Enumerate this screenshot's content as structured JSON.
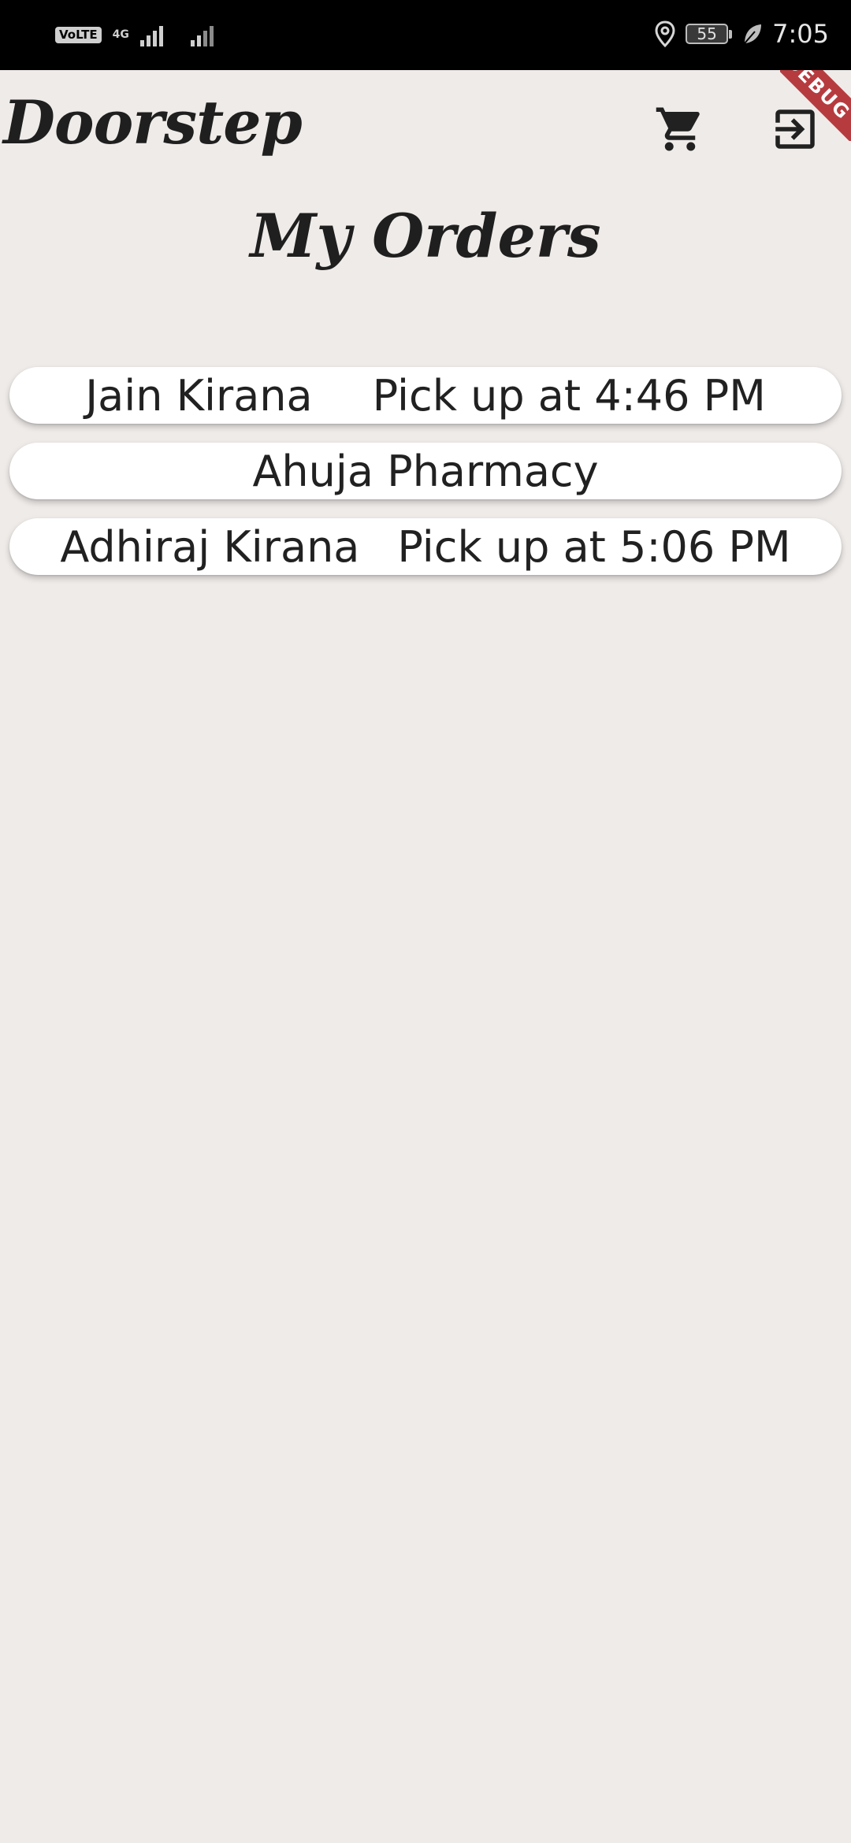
{
  "status_bar": {
    "network_badge": "VoLTE",
    "network_type": "4G",
    "battery": "55",
    "time": "7:05",
    "icons": [
      "signal-icon",
      "location-icon",
      "battery-icon",
      "leaf-icon"
    ]
  },
  "debug_banner": "DEBUG",
  "app_bar": {
    "brand": "Doorstep",
    "actions": [
      "cart-icon",
      "logout-icon"
    ]
  },
  "page": {
    "title": "My Orders"
  },
  "orders": [
    {
      "store": "Jain Kirana",
      "pickup": "Pick up at 4:46 PM"
    },
    {
      "store": "Ahuja Pharmacy",
      "pickup": ""
    },
    {
      "store": "Adhiraj Kirana",
      "pickup": "Pick up at 5:06 PM"
    }
  ],
  "colors": {
    "background": "#efebe9",
    "card": "#ffffff",
    "text": "#212121",
    "status_bar": "#000000",
    "debug_banner": "#b0282d"
  }
}
